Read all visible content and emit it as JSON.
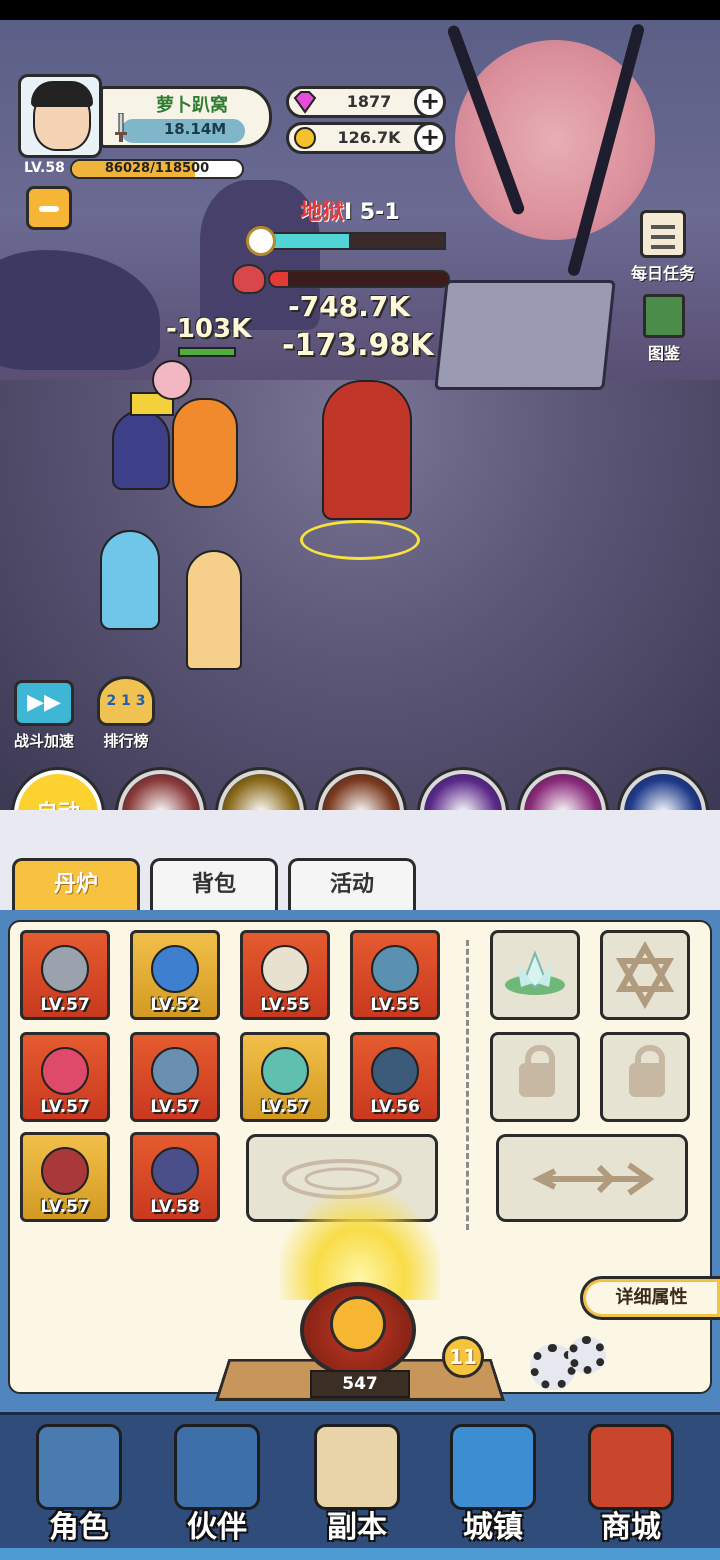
{
  "player": {
    "name": "萝卜趴窝",
    "power": "18.14M",
    "level": "LV.58",
    "exp": "86028/118500",
    "exp_fraction": 0.726
  },
  "resources": {
    "gems": "1877",
    "coins": "126.7K"
  },
  "stage": {
    "mode": "地狱",
    "level": "5-1",
    "progress_fraction": 0.45,
    "boss_hp_fraction": 0.1
  },
  "damage_numbers": [
    "-748.7K",
    "-103K",
    "-173.98K"
  ],
  "side_menu": {
    "daily_task": "每日任务",
    "codex": "图鉴"
  },
  "battle_controls": {
    "speed": "战斗加速",
    "rank": "排行榜",
    "auto": "自动"
  },
  "skills": [
    {
      "icon": "wolf-skill-icon",
      "color": "#8a3a3a"
    },
    {
      "icon": "swords-skill-icon",
      "color": "#8a6a1a"
    },
    {
      "icon": "whirlwind-skill-icon",
      "color": "#7a3a1f"
    },
    {
      "icon": "lightning-orb-skill-icon",
      "color": "#5a2a8a"
    },
    {
      "icon": "pink-vortex-skill-icon",
      "color": "#8a2a7a"
    },
    {
      "icon": "blue-comet-skill-icon",
      "color": "#1f3a8a"
    }
  ],
  "tabs": [
    "丹炉",
    "背包",
    "活动"
  ],
  "equipment": [
    {
      "name": "sword-item-icon",
      "level": "LV.57",
      "frame": "red"
    },
    {
      "name": "helmet-item-icon",
      "level": "LV.52",
      "frame": "gold"
    },
    {
      "name": "robe-item-icon",
      "level": "LV.55",
      "frame": "red"
    },
    {
      "name": "dragon-orb-item-icon",
      "level": "LV.55",
      "frame": "red"
    },
    {
      "name": "gourd-item-icon",
      "level": "LV.57",
      "frame": "red"
    },
    {
      "name": "bagua-item-icon",
      "level": "LV.57",
      "frame": "red"
    },
    {
      "name": "jade-ring-item-icon",
      "level": "LV.57",
      "frame": "gold"
    },
    {
      "name": "phoenix-orb-item-icon",
      "level": "LV.56",
      "frame": "red"
    },
    {
      "name": "belt-item-icon",
      "level": "LV.57",
      "frame": "gold"
    },
    {
      "name": "boots-item-icon",
      "level": "LV.58",
      "frame": "red"
    }
  ],
  "detail_button": "详细属性",
  "furnace": {
    "count": "547",
    "level": "11"
  },
  "nav": [
    "角色",
    "伙伴",
    "副本",
    "城镇",
    "商城"
  ]
}
